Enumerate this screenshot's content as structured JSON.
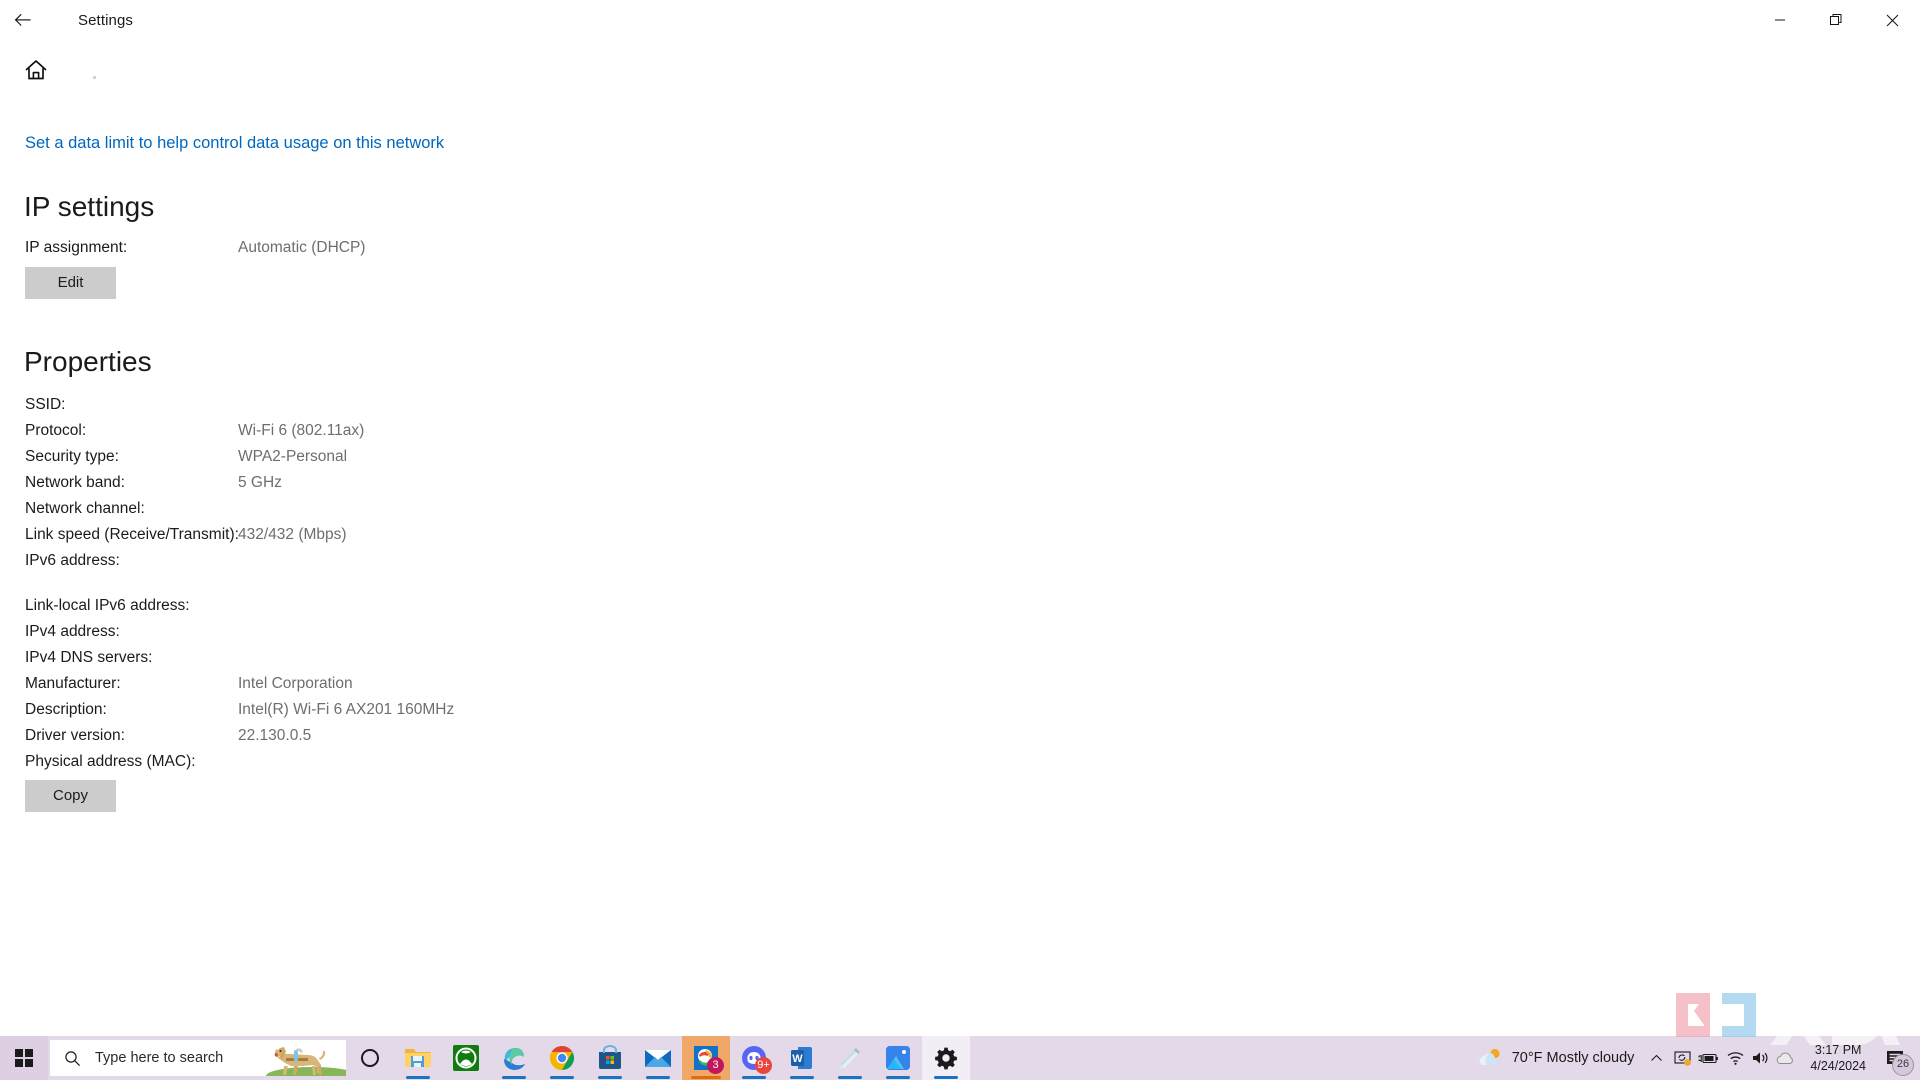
{
  "window": {
    "title": "Settings",
    "back_icon": "back-arrow-icon",
    "minimize_label": "Minimize",
    "restore_label": "Restore",
    "close_label": "Close"
  },
  "page": {
    "home_icon": "home-icon",
    "data_limit_link": "Set a data limit to help control data usage on this network",
    "link_color": "#0067c0"
  },
  "ip_settings": {
    "heading": "IP settings",
    "rows": [
      {
        "label": "IP assignment:",
        "value": "Automatic (DHCP)"
      }
    ],
    "edit_button": "Edit"
  },
  "properties": {
    "heading": "Properties",
    "rows": [
      {
        "label": "SSID:",
        "value": ""
      },
      {
        "label": "Protocol:",
        "value": "Wi-Fi 6 (802.11ax)"
      },
      {
        "label": "Security type:",
        "value": "WPA2-Personal"
      },
      {
        "label": "Network band:",
        "value": "5 GHz"
      },
      {
        "label": "Network channel:",
        "value": ""
      },
      {
        "label": "Link speed (Receive/Transmit):",
        "value": "432/432 (Mbps)"
      },
      {
        "label": "IPv6 address:",
        "value": ""
      },
      {
        "label": "Link-local IPv6 address:",
        "value": ""
      },
      {
        "label": "IPv4 address:",
        "value": ""
      },
      {
        "label": "IPv4 DNS servers:",
        "value": ""
      },
      {
        "label": "Manufacturer:",
        "value": "Intel Corporation"
      },
      {
        "label": "Description:",
        "value": "Intel(R) Wi-Fi 6 AX201 160MHz"
      },
      {
        "label": "Driver version:",
        "value": "22.130.0.5"
      },
      {
        "label": "Physical address (MAC):",
        "value": ""
      }
    ],
    "copy_button": "Copy"
  },
  "taskbar": {
    "start_icon": "windows-start-icon",
    "search": {
      "placeholder": "Type here to search",
      "icon": "search-icon",
      "illustration": "guide-dog-illustration"
    },
    "items": [
      {
        "name": "cortana-icon",
        "running": false,
        "badge": ""
      },
      {
        "name": "file-explorer-icon",
        "running": true,
        "badge": ""
      },
      {
        "name": "xbox-icon",
        "running": false,
        "badge": ""
      },
      {
        "name": "microsoft-edge-icon",
        "running": true,
        "badge": ""
      },
      {
        "name": "google-chrome-icon",
        "running": true,
        "badge": ""
      },
      {
        "name": "microsoft-store-icon",
        "running": true,
        "badge": ""
      },
      {
        "name": "mail-icon",
        "running": true,
        "badge": ""
      },
      {
        "name": "messaging-app-icon",
        "running": true,
        "badge": "3"
      },
      {
        "name": "discord-icon",
        "running": true,
        "badge": "9+"
      },
      {
        "name": "microsoft-word-icon",
        "running": true,
        "badge": ""
      },
      {
        "name": "sticky-notes-icon",
        "running": true,
        "badge": ""
      },
      {
        "name": "photos-icon",
        "running": true,
        "badge": ""
      },
      {
        "name": "settings-gear-icon",
        "running": true,
        "badge": ""
      }
    ],
    "weather": {
      "temperature": "70°F",
      "condition": "Mostly cloudy",
      "text": "70°F  Mostly cloudy",
      "icon": "partly-cloudy-icon"
    },
    "tray": {
      "show_hidden_icons": "chevron-up-icon",
      "icons": [
        "onedrive-sync-icon",
        "battery-charging-icon",
        "wifi-icon",
        "volume-icon",
        "cloud-icon"
      ]
    },
    "clock": {
      "time": "3:17 PM",
      "date": "4/24/2024"
    },
    "notifications": {
      "icon": "notification-icon",
      "count": "26"
    }
  },
  "watermark": {
    "text": "XDA"
  }
}
